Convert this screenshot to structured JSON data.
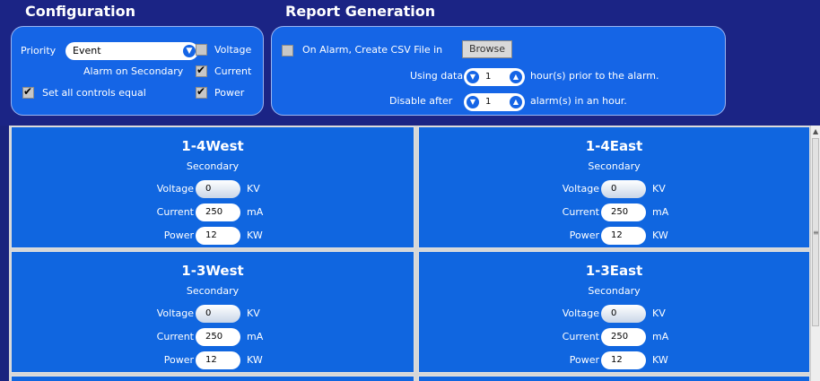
{
  "configuration": {
    "title": "Configuration",
    "priority_label": "Priority",
    "priority_value": "Event",
    "voltage_label": "Voltage",
    "voltage_checked": false,
    "alarm_secondary_label": "Alarm on Secondary",
    "current_label": "Current",
    "current_checked": true,
    "set_all_label": "Set all controls equal",
    "set_all_checked": true,
    "power_label": "Power",
    "power_checked": true
  },
  "report": {
    "title": "Report Generation",
    "on_alarm_label": "On Alarm, Create CSV File in",
    "on_alarm_checked": false,
    "browse_label": "Browse",
    "using_data_label": "Using data",
    "using_data_value": "1",
    "hours_prior_label": "hour(s) prior to the alarm.",
    "disable_after_label": "Disable after",
    "disable_after_value": "1",
    "alarms_label": "alarm(s) in an hour."
  },
  "cells": [
    {
      "name": "1-4West",
      "sub": "Secondary",
      "voltage_label": "Voltage",
      "voltage": "0",
      "voltage_unit": "KV",
      "current_label": "Current",
      "current": "250",
      "current_unit": "mA",
      "power_label": "Power",
      "power": "12",
      "power_unit": "KW"
    },
    {
      "name": "1-4East",
      "sub": "Secondary",
      "voltage_label": "Voltage",
      "voltage": "0",
      "voltage_unit": "KV",
      "current_label": "Current",
      "current": "250",
      "current_unit": "mA",
      "power_label": "Power",
      "power": "12",
      "power_unit": "KW"
    },
    {
      "name": "1-3West",
      "sub": "Secondary",
      "voltage_label": "Voltage",
      "voltage": "0",
      "voltage_unit": "KV",
      "current_label": "Current",
      "current": "250",
      "current_unit": "mA",
      "power_label": "Power",
      "power": "12",
      "power_unit": "KW"
    },
    {
      "name": "1-3East",
      "sub": "Secondary",
      "voltage_label": "Voltage",
      "voltage": "0",
      "voltage_unit": "KV",
      "current_label": "Current",
      "current": "250",
      "current_unit": "mA",
      "power_label": "Power",
      "power": "12",
      "power_unit": "KW"
    }
  ],
  "icons": {
    "dropdown": "chevron-down-icon",
    "spin_down": "chevron-down-icon",
    "spin_up": "chevron-up-icon",
    "check": "checkmark-icon"
  },
  "colors": {
    "background": "#1b2485",
    "panel": "#1565e6",
    "cell": "#1066e0"
  }
}
